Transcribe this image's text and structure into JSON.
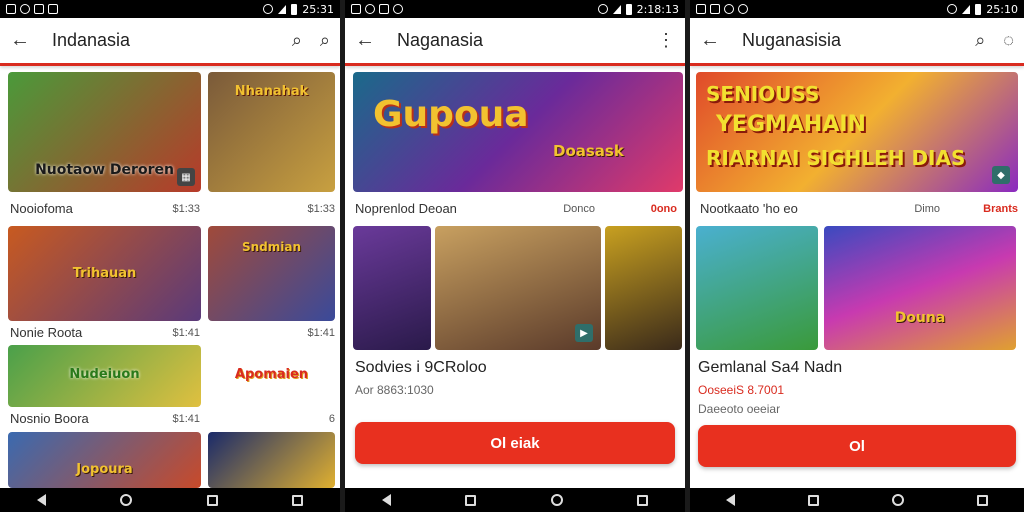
{
  "screens": [
    {
      "status_time": "25:31",
      "title": "Indanasia",
      "actions": [
        "search-icon",
        "search-icon"
      ],
      "tiles": [
        {
          "text": "Nuotaow Deroren",
          "colors": [
            "#4a9a3a",
            "#b83a2a"
          ]
        },
        {
          "text": "Nhanahak",
          "colors": [
            "#7a5a3a",
            "#c8a040"
          ]
        },
        {
          "text": "Trihauan",
          "colors": [
            "#c85a20",
            "#5a3a7a"
          ]
        },
        {
          "text": "Sndmian",
          "colors": [
            "#a04a3a",
            "#3a4a9a"
          ]
        },
        {
          "text": "Nudeiuon",
          "colors": [
            "#4aa04a",
            "#e0c040"
          ]
        },
        {
          "text": "Apomaien",
          "colors": [
            "#ffffff",
            "#e0a020"
          ]
        },
        {
          "text": "Jopoura",
          "colors": [
            "#3a6ab0",
            "#c84a2a"
          ]
        },
        {
          "text": "",
          "colors": [
            "#1a2a6a",
            "#e0b030"
          ]
        }
      ],
      "captions": [
        {
          "title": "Nooiofoma",
          "meta": "$1:33"
        },
        {
          "title": "",
          "meta": "$1:33"
        },
        {
          "title": "Nonie Roota",
          "meta": "$1:41"
        },
        {
          "title": "Nonie Roota",
          "meta": "$1:41"
        },
        {
          "title": "Nosnio Boora",
          "meta": "$1:41"
        },
        {
          "title": "",
          "meta": "6"
        }
      ]
    },
    {
      "status_time": "2:18:13",
      "title": "Naganasia",
      "menu_icon": "more-vert-icon",
      "hero_text": "Gupoua",
      "hero_sub": "Doasask",
      "caption_title": "Noprenlod Deoan",
      "caption_meta": "Donco",
      "caption_badge": "0ono",
      "thumbs": [
        "#6a3a9a",
        "#5a3a2a",
        "#c8a020"
      ],
      "big_note": "Sodvies i 9CRoloo",
      "sub_note": "Aor 8863:1030",
      "cta": "Ol eiak"
    },
    {
      "status_time": "25:10",
      "title": "Nuganasisia",
      "hero_lines": [
        "SENIOUSS",
        "YEGMAHAIN",
        "RIARNAI SIGHLEH DIAS"
      ],
      "caption_title": "Nootkaato 'ho eo",
      "caption_meta": "Dimo",
      "caption_badge": "Brants",
      "thumb1_text": "",
      "thumb2_text": "Douna",
      "big_note": "Gemlanal Sa4 Nadn",
      "sub_note1": "OoseeiS 8.7001",
      "sub_note2": "Daeeoto oeeiar",
      "cta": "Ol"
    }
  ]
}
